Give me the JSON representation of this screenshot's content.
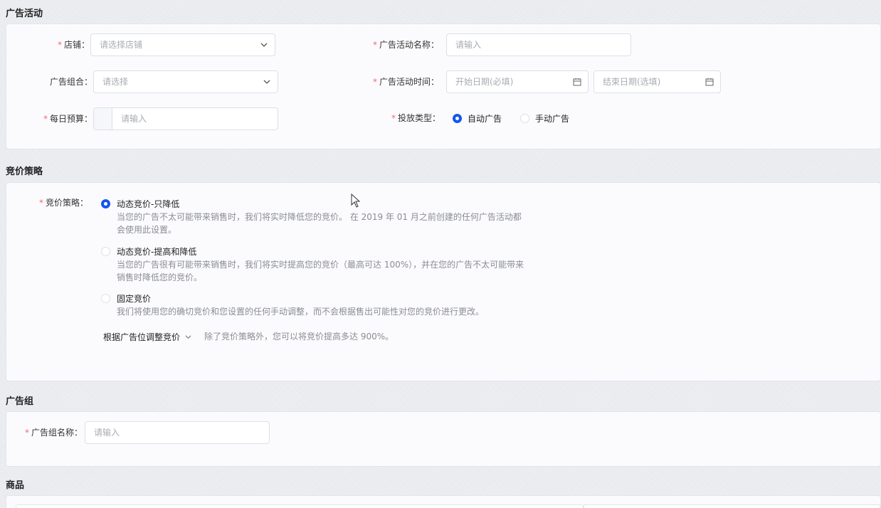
{
  "campaign": {
    "title": "广告活动",
    "shop_label": "店铺：",
    "shop_placeholder": "请选择店铺",
    "name_label": "广告活动名称：",
    "name_placeholder": "请输入",
    "group_label": "广告组合：",
    "group_placeholder": "请选择",
    "time_label": "广告活动时间：",
    "start_placeholder": "开始日期(必填)",
    "end_placeholder": "结束日期(选填)",
    "budget_label": "每日预算：",
    "budget_placeholder": "请输入",
    "type_label": "投放类型：",
    "type_auto": "自动广告",
    "type_manual": "手动广告"
  },
  "bidding": {
    "title": "竞价策略",
    "label": "竞价策略：",
    "options": [
      {
        "title": "动态竞价-只降低",
        "desc": "当您的广告不太可能带来销售时，我们将实时降低您的竞价。 在 2019 年 01 月之前创建的任何广告活动都会使用此设置。"
      },
      {
        "title": "动态竞价-提高和降低",
        "desc": "当您的广告很有可能带来销售时，我们将实时提高您的竞价（最高可达 100%），并在您的广告不太可能带来销售时降低您的竞价。"
      },
      {
        "title": "固定竞价",
        "desc": "我们将使用您的确切竞价和您设置的任何手动调整，而不会根据售出可能性对您的竞价进行更改。"
      }
    ],
    "adjust_label": "根据广告位调整竞价",
    "adjust_desc": "除了竞价策略外，您可以将竞价提高多达 900%。"
  },
  "adgroup": {
    "title": "广告组",
    "name_label": "广告组名称：",
    "name_placeholder": "请输入"
  },
  "product": {
    "title": "商品"
  },
  "required_mark": "*",
  "colors": {
    "accent": "#1456f0",
    "required": "#f56c6c"
  }
}
